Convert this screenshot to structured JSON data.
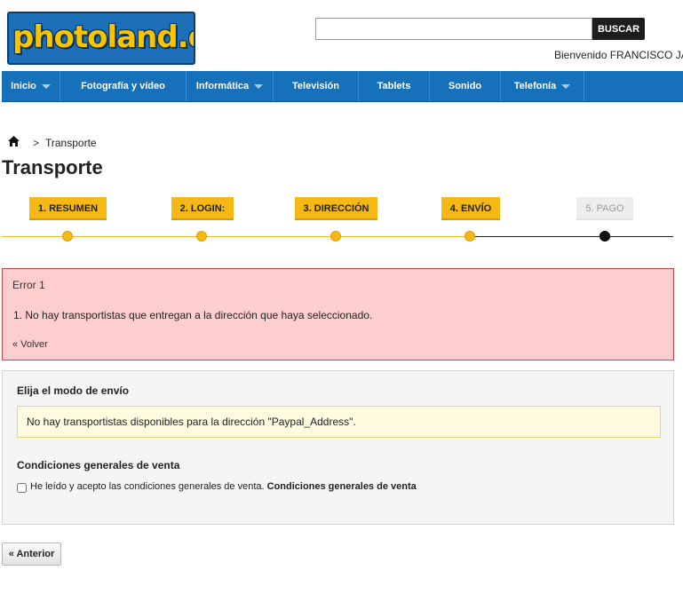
{
  "brand": {
    "logo_text": "photoland.es",
    "blue": "#1670ba",
    "yellow": "#f5b815"
  },
  "search": {
    "value": "",
    "placeholder": "",
    "button_label": "BUSCAR"
  },
  "header": {
    "welcome": "Bienvenido FRANCISCO JA"
  },
  "nav": {
    "items": [
      {
        "label": "Inicio",
        "has_dropdown": true
      },
      {
        "label": "Fotografía y vídeo",
        "has_dropdown": false
      },
      {
        "label": "Informática",
        "has_dropdown": true
      },
      {
        "label": "Televisión",
        "has_dropdown": false
      },
      {
        "label": "Tablets",
        "has_dropdown": false
      },
      {
        "label": "Sonido",
        "has_dropdown": false
      },
      {
        "label": "Telefonía",
        "has_dropdown": true
      }
    ]
  },
  "breadcrumb": {
    "home_icon": "home-icon",
    "separator": ">",
    "current": "Transporte"
  },
  "page": {
    "title": "Transporte"
  },
  "steps": [
    {
      "label": "1. RESUMEN",
      "state": "done"
    },
    {
      "label": "2. LOGIN:",
      "state": "done"
    },
    {
      "label": "3. DIRECCIÓN",
      "state": "done"
    },
    {
      "label": "4. ENVÍO",
      "state": "current"
    },
    {
      "label": "5. PAGO",
      "state": "todo"
    }
  ],
  "error": {
    "title": "Error 1",
    "messages": [
      "1.  No hay transportistas que entregan a la dirección que haya seleccionado."
    ],
    "back_link": "« Volver"
  },
  "shipping": {
    "title": "Elija el modo de envío",
    "warning": "No hay transportistas disponibles para la dirección \"Paypal_Address\"."
  },
  "terms": {
    "title": "Condiciones generales de venta",
    "checkbox_label": "He leído y acepto las condiciones generales de venta.",
    "link_label": "Condiciones generales de venta",
    "checked": false
  },
  "footer": {
    "prev_button": "« Anterior"
  }
}
